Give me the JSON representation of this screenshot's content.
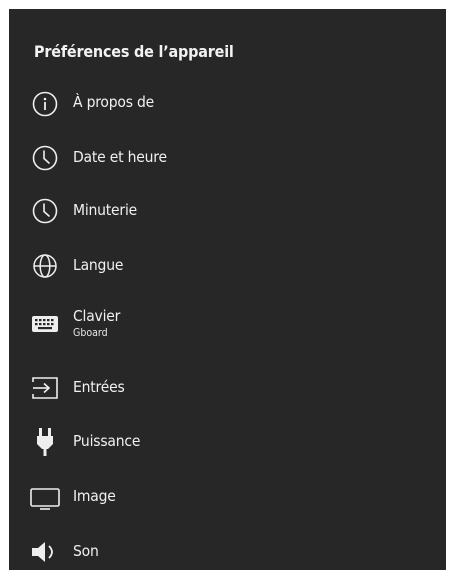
{
  "panel": {
    "title": "Préférences de l’appareil",
    "items": [
      {
        "label": "À propos de",
        "icon": "info-icon"
      },
      {
        "label": "Date et heure",
        "icon": "clock-icon"
      },
      {
        "label": "Minuterie",
        "icon": "clock-icon"
      },
      {
        "label": "Langue",
        "icon": "globe-icon"
      },
      {
        "label": "Clavier",
        "sublabel": "Gboard",
        "icon": "keyboard-icon"
      },
      {
        "label": "Entrées",
        "icon": "input-icon"
      },
      {
        "label": "Puissance",
        "icon": "power-plug-icon"
      },
      {
        "label": "Image",
        "icon": "display-icon"
      },
      {
        "label": "Son",
        "icon": "speaker-icon"
      }
    ]
  }
}
